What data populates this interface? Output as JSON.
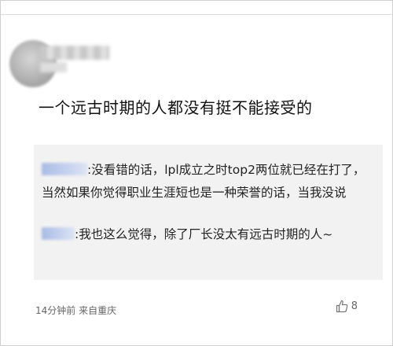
{
  "comment": {
    "text": "一个远古时期的人都没有挺不能接受的",
    "meta": "14分钟前 来自重庆",
    "like_count": "8"
  },
  "replies": [
    {
      "text": ":没看错的话，lpl成立之时top2两位就已经在打了，当然如果你觉得职业生涯短也是一种荣誉的话，当我没说"
    },
    {
      "text": ":我也这么觉得，除了厂长没太有远古时期的人~"
    }
  ],
  "icons": {
    "like": "thumbs-up-icon"
  }
}
